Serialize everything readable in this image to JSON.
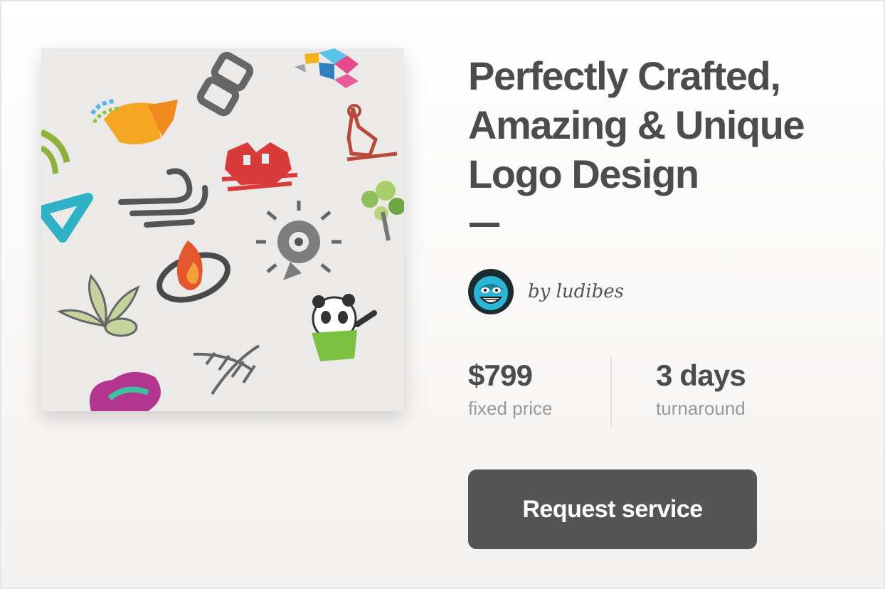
{
  "service": {
    "title": "Perfectly Crafted, Amazing & Unique Logo Design",
    "author": "by ludibes",
    "image_subject": "logo-collage",
    "avatar_subject": "blue-face-avatar"
  },
  "stats": {
    "price_value": "$799",
    "price_label": "fixed price",
    "turnaround_value": "3 days",
    "turnaround_label": "turnaround"
  },
  "actions": {
    "request_label": "Request service"
  },
  "colors": {
    "text": "#4c4c4c",
    "muted": "#999999",
    "button": "#555555",
    "button_text": "#ffffff"
  }
}
